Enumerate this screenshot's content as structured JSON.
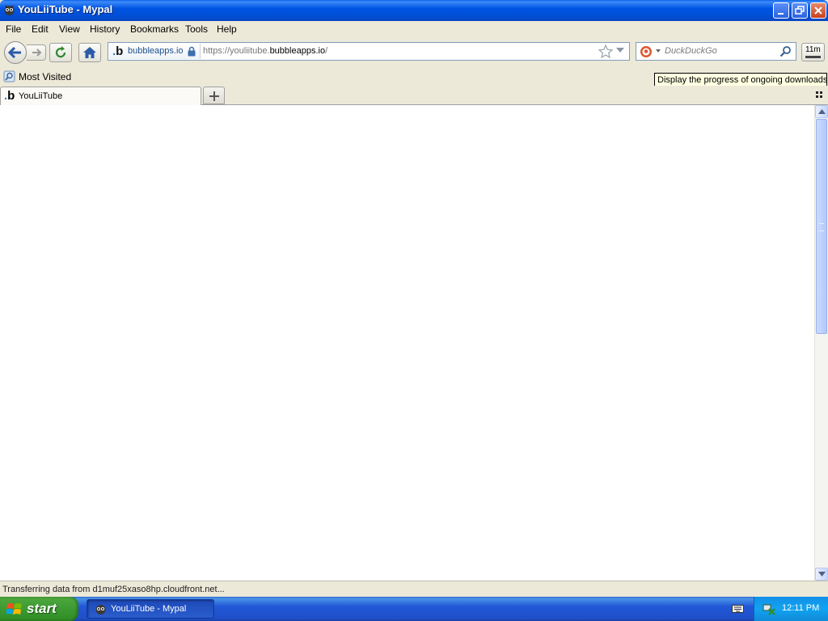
{
  "window": {
    "title": "YouLiiTube - Mypal"
  },
  "menu": {
    "items": [
      {
        "label": "File"
      },
      {
        "label": "Edit"
      },
      {
        "label": "View"
      },
      {
        "label": "History"
      },
      {
        "label": "Bookmarks"
      },
      {
        "label": "Tools"
      },
      {
        "label": "Help"
      }
    ]
  },
  "urlbar": {
    "identity_logo": "b",
    "identity_domain": "bubbleapps.io",
    "url_prefix": "https://youliitube.",
    "url_domain": "bubbleapps.io",
    "url_suffix": "/"
  },
  "search": {
    "engine_icon": "duckduckgo-icon",
    "placeholder": "DuckDuckGo"
  },
  "downloads": {
    "time_left": "11m",
    "tooltip": "Display the progress of ongoing downloads"
  },
  "bookmarks": {
    "most_visited": "Most Visited"
  },
  "tabs": [
    {
      "label": "YouLiiTube",
      "favicon": "b"
    }
  ],
  "status": {
    "text": "Transferring data from d1muf25xaso8hp.cloudfront.net..."
  },
  "taskbar": {
    "start_label": "start",
    "task_label": "YouLiiTube - Mypal",
    "clock": "12:11 PM"
  },
  "colors": {
    "titlebar": "#0054e3",
    "chrome": "#ece9d8",
    "start_green": "#3d9b33",
    "taskbar_blue": "#2157d7",
    "tray_blue": "#12a3f0"
  }
}
